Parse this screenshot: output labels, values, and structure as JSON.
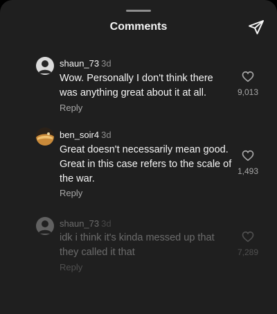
{
  "header": {
    "title": "Comments"
  },
  "icons": {
    "share": "paper-plane-icon",
    "like": "heart-outline-icon",
    "avatar_default": "default-avatar-icon"
  },
  "comments": [
    {
      "username": "shaun_73",
      "time": "3d",
      "text": "Wow. Personally I don't think there was anything great about it at all.",
      "likes": "9,013",
      "reply_label": "Reply"
    },
    {
      "username": "ben_soir4",
      "time": "3d",
      "text": "Great doesn't necessarily mean good. Great in this case refers to the scale of the war.",
      "likes": "1,493",
      "reply_label": "Reply"
    },
    {
      "username": "shaun_73",
      "time": "3d",
      "text": "idk i think it's kinda messed up that they called it that",
      "likes": "7,289",
      "reply_label": "Reply"
    }
  ]
}
